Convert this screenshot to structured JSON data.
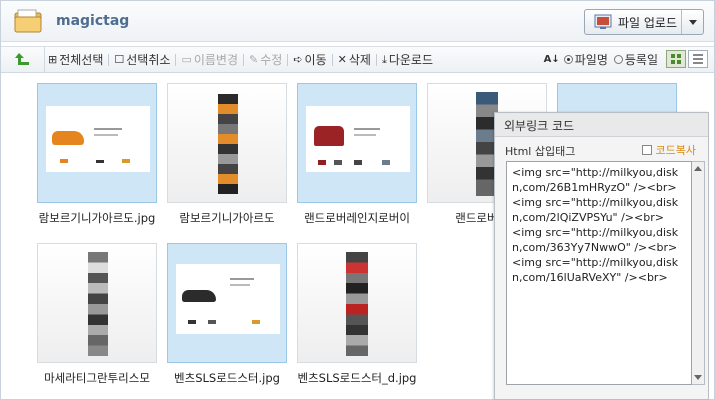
{
  "header": {
    "app_title": "magictag",
    "upload_label": "파일 업로드"
  },
  "toolbar": {
    "select_all": "전체선택",
    "deselect": "선택취소",
    "rename": "이름변경",
    "edit": "수정",
    "move": "이동",
    "delete": "삭제",
    "download": "다운로드",
    "sort_filename": "파일명",
    "sort_date": "등록일"
  },
  "files": [
    {
      "name": "람보르기니가아르도.jpg",
      "selected": true
    },
    {
      "name": "람보르기니가아르도",
      "selected": false
    },
    {
      "name": "랜드로버레인지로버이",
      "selected": true
    },
    {
      "name": "랜드로버레인",
      "selected": false
    },
    {
      "name": "",
      "selected": true
    },
    {
      "name": "마세라티그란투리스모",
      "selected": false
    },
    {
      "name": "벤츠SLS로드스터.jpg",
      "selected": true
    },
    {
      "name": "벤츠SLS로드스터_d.jpg",
      "selected": false
    }
  ],
  "popup": {
    "title": "외부링크 코드",
    "subtitle": "Html 삽입태그",
    "copy_label": "코드복사",
    "code": "<img src=\"http://milkyou,diskn,com/26B1mHRyzO\" /><br>\n<img src=\"http://milkyou,diskn,com/2lQiZVPSYu\" /><br>\n<img src=\"http://milkyou,diskn,com/363Yy7NwwO\" /><br>\n<img src=\"http://milkyou,diskn,com/16lUaRVeXY\" /><br>"
  },
  "colors": {
    "accent": "#4f6d8f",
    "selected_bg": "#cfe6f7",
    "copy_link": "#d9890d"
  }
}
